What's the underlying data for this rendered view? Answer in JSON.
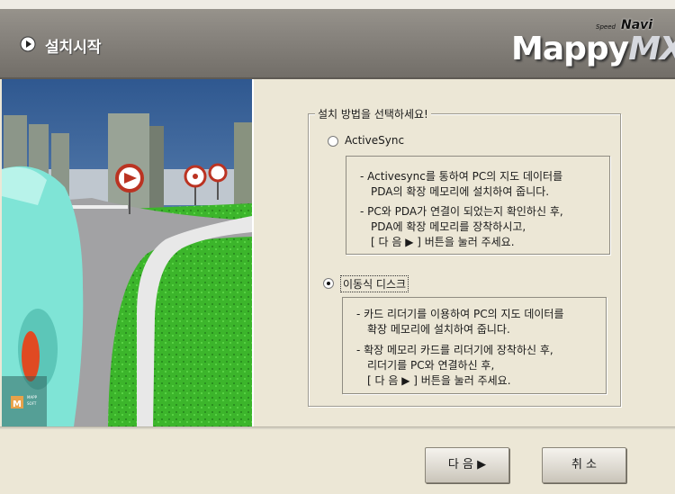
{
  "header": {
    "title": "설치시작",
    "logo": {
      "brand": "MappyMX",
      "brand_main": "Mappy",
      "brand_suffix": "MX",
      "navi": "Navi",
      "speed": "Speed"
    }
  },
  "illustration": {
    "corner_logo_letter": "M",
    "corner_logo_text_1": "MAPP",
    "corner_logo_text_2": "SOFT",
    "colors": {
      "sky": "#4a6fa3",
      "grass": "#39b52a",
      "road": "#9a9a9c",
      "car": "#7fe4d6"
    }
  },
  "install": {
    "group_title": "설치 방법을 선택하세요!",
    "options": [
      {
        "label": "ActiveSync",
        "selected": false,
        "desc": [
          "- Activesync를 통하여 PC의 지도 데이터를",
          "PDA의 확장 메모리에 설치하여 줍니다.",
          "- PC와 PDA가 연결이 되었는지 확인하신 후,",
          "PDA에 확장 메모리를 장착하시고,",
          "[ 다 음  ▶ ] 버튼을 눌러 주세요."
        ]
      },
      {
        "label": "이동식 디스크",
        "selected": true,
        "desc": [
          "- 카드 리더기를 이용하여 PC의 지도 데이터를",
          "확장 메모리에 설치하여 줍니다.",
          "- 확장 메모리 카드를 리더기에 장착하신 후,",
          "리더기를 PC와 연결하신 후,",
          "[ 다 음  ▶ ] 버튼을 눌러 주세요."
        ]
      }
    ]
  },
  "buttons": {
    "next": "다 음 ▶",
    "cancel": "취 소"
  }
}
